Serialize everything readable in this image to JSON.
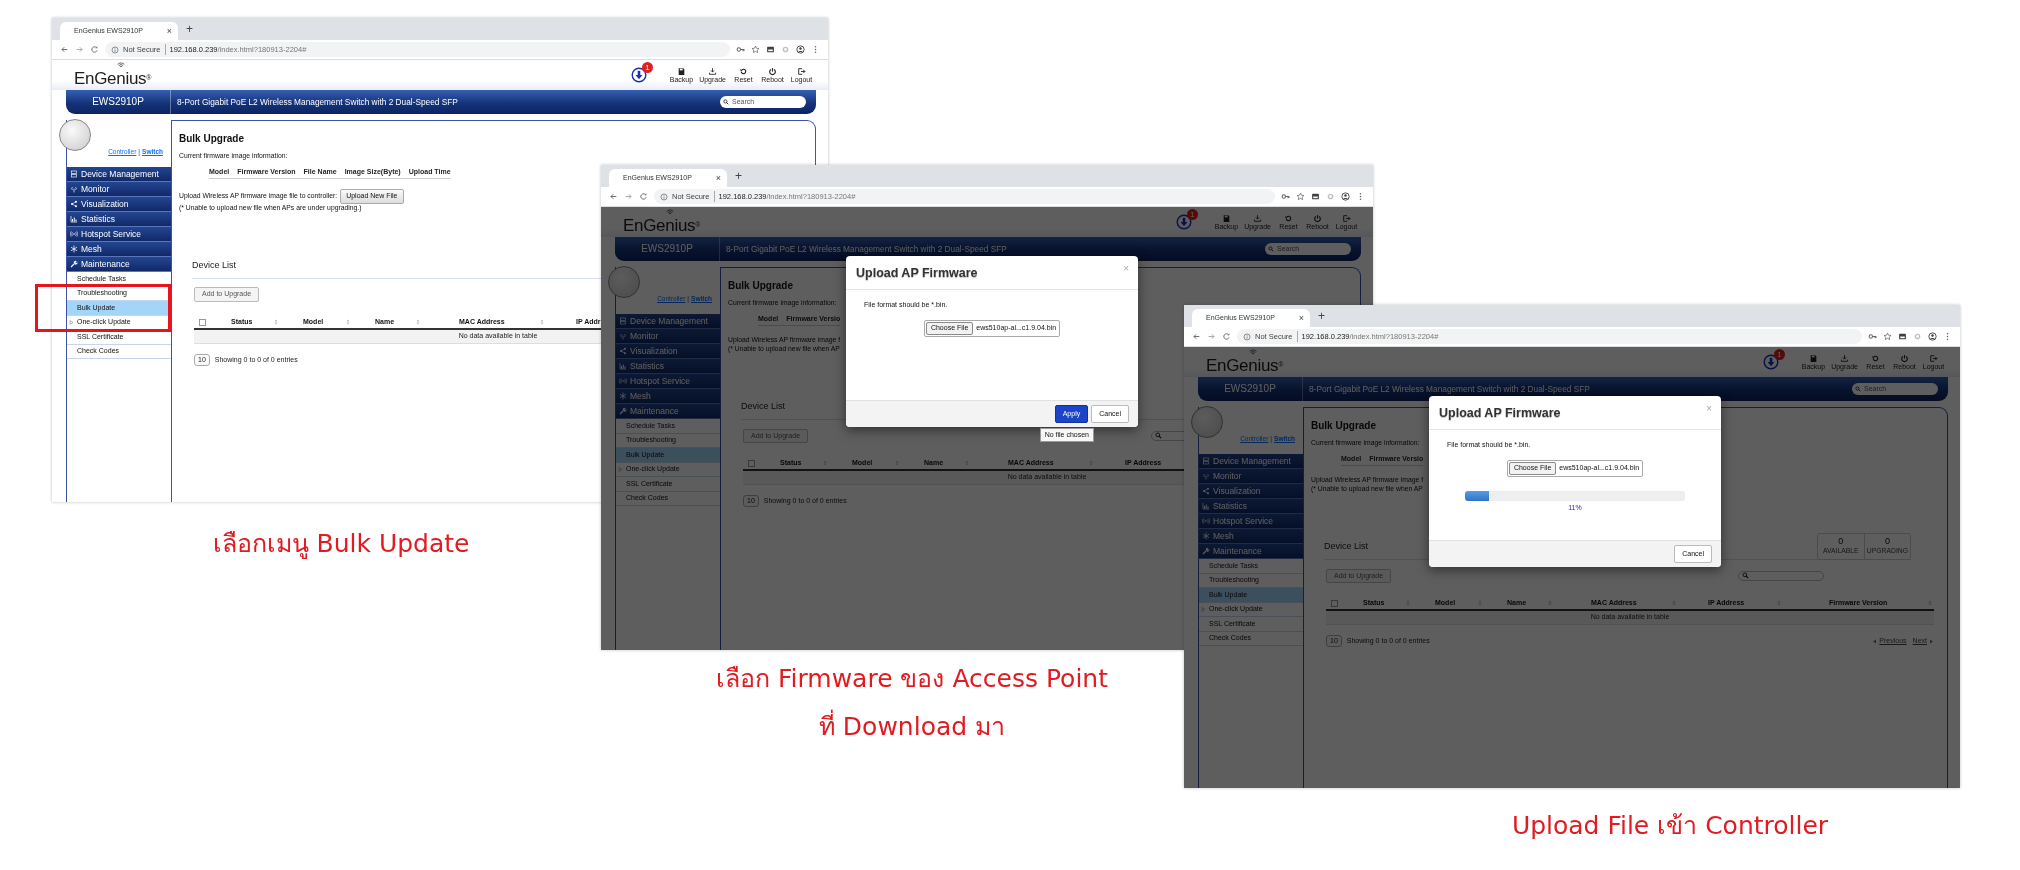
{
  "screenshots": [
    {
      "browser": {
        "tab_title": "EnGenius EWS2910P",
        "tab_close": "×",
        "new_tab": "+",
        "security": "Not Secure",
        "url": "**192.168.0.239**/index.html?180913-2204#"
      },
      "header": {
        "logo": "EnGenius$^{®}$",
        "notifications": "1",
        "toolbar": [
          "Backup",
          "Upgrade",
          "Reset",
          "Reboot",
          "Logout"
        ],
        "model": "EWS2910P",
        "description": "8-Port Gigabit PoE L2 Wireless Management Switch with 2 Dual-Speed SFP",
        "search_placeholder": "Search"
      },
      "sidebar": {
        "links": [
          "Controller",
          "Switch"
        ],
        "separator": "|",
        "menu": [
          "Device Management",
          "Monitor",
          "Visualization",
          "Statistics",
          "Hotspot Service",
          "Mesh",
          "Maintenance"
        ],
        "submenu": [
          {
            "label": "Schedule Tasks",
            "selected": false,
            "expandable": false,
            "highlighted": false
          },
          {
            "label": "Troubleshooting",
            "selected": false,
            "expandable": false,
            "highlighted": true
          },
          {
            "label": "Bulk Update",
            "selected": true,
            "expandable": false,
            "highlighted": true
          },
          {
            "label": "One-click Update",
            "selected": false,
            "expandable": true,
            "highlighted": true
          },
          {
            "label": "SSL Certificate",
            "selected": false,
            "expandable": false,
            "highlighted": false
          },
          {
            "label": "Check Codes",
            "selected": false,
            "expandable": false,
            "highlighted": false
          }
        ]
      },
      "main": {
        "title": "Bulk Upgrade",
        "info_label": "Current firmware image information:",
        "firmware_columns": [
          "Model",
          "Firmware Version",
          "File Name",
          "Image Size(Byte)",
          "Upload Time"
        ],
        "upload_label": "Upload Wireless AP firmware image file to controller:",
        "upload_button": "Upload New File",
        "note": "(* Unable to upload new file when APs are under upgrading.)",
        "device_list_title": "Device List",
        "add_button": {
          "label": "Add to Upgrade",
          "disabled": true
        },
        "select_all_checked": false,
        "columns": [
          "Status",
          "Model",
          "Name",
          "MAC Address",
          "IP Addr"
        ],
        "empty_text": "No data available in table",
        "page_size": "10",
        "entries": "Showing 0 to 0 of 0 entries"
      }
    },
    {
      "browser": {
        "tab_title": "EnGenius EWS2910P",
        "tab_close": "×",
        "new_tab": "+",
        "security": "Not Secure",
        "url": "**192.168.0.239**/index.html?180913-2204#"
      },
      "header": {
        "logo": "EnGenius$^{®}$",
        "notifications": "1",
        "toolbar": [
          "Backup",
          "Upgrade",
          "Reset",
          "Reboot",
          "Logout"
        ],
        "model": "EWS2910P",
        "description": "8-Port Gigabit PoE L2 Wireless Management Switch with 2 Dual-Speed SFP",
        "search_placeholder": "Search"
      },
      "sidebar": {
        "links": [
          "Controller",
          "Switch"
        ],
        "separator": "|",
        "menu": [
          "Device Management",
          "Monitor",
          "Visualization",
          "Statistics",
          "Hotspot Service",
          "Mesh",
          "Maintenance"
        ],
        "submenu": [
          {
            "label": "Schedule Tasks",
            "selected": false,
            "expandable": false
          },
          {
            "label": "Troubleshooting",
            "selected": false,
            "expandable": false
          },
          {
            "label": "Bulk Update",
            "selected": true,
            "expandable": false
          },
          {
            "label": "One-click Update",
            "selected": false,
            "expandable": true
          },
          {
            "label": "SSL Certificate",
            "selected": false,
            "expandable": false
          },
          {
            "label": "Check Codes",
            "selected": false,
            "expandable": false
          }
        ]
      },
      "main": {
        "title": "Bulk Upgrade",
        "info_label": "Current firmware image information:",
        "firmware_columns": [
          "Model",
          "Firmware Versio"
        ],
        "upload_label": "Upload Wireless AP firmware image f",
        "note": "(* Unable to upload new file when AP",
        "device_list_title": "Device List",
        "add_button": {
          "label": "Add to Upgrade",
          "disabled": true
        },
        "show_search": true,
        "select_all_checked": false,
        "columns": [
          "Status",
          "Model",
          "Name",
          "MAC Address",
          "IP Address"
        ],
        "empty_text": "No data available in table",
        "page_size": "10",
        "entries": "Showing 0 to 0 of 0 entries"
      },
      "modal": {
        "title": "Upload AP Firmware",
        "close": "×",
        "hint": "File format should be *.bin.",
        "choose_button": "Choose File",
        "file_name": "ews510ap-al...c1.9.04.bin",
        "buttons": [
          {
            "label": "Apply",
            "kind": "primary"
          },
          {
            "label": "Cancel",
            "kind": "default"
          }
        ],
        "tooltip": "No file chosen"
      }
    },
    {
      "browser": {
        "tab_title": "EnGenius EWS2910P",
        "tab_close": "×",
        "new_tab": "+",
        "security": "Not Secure",
        "url": "**192.168.0.239**/index.html?180913-2204#"
      },
      "header": {
        "logo": "EnGenius$^{®}$",
        "notifications": "1",
        "toolbar": [
          "Backup",
          "Upgrade",
          "Reset",
          "Reboot",
          "Logout"
        ],
        "model": "EWS2910P",
        "description": "8-Port Gigabit PoE L2 Wireless Management Switch with 2 Dual-Speed SFP",
        "search_placeholder": "Search"
      },
      "sidebar": {
        "links": [
          "Controller",
          "Switch"
        ],
        "separator": "|",
        "menu": [
          "Device Management",
          "Monitor",
          "Visualization",
          "Statistics",
          "Hotspot Service",
          "Mesh",
          "Maintenance"
        ],
        "submenu": [
          {
            "label": "Schedule Tasks",
            "selected": false,
            "expandable": false
          },
          {
            "label": "Troubleshooting",
            "selected": false,
            "expandable": false
          },
          {
            "label": "Bulk Update",
            "selected": true,
            "expandable": false
          },
          {
            "label": "One-click Update",
            "selected": false,
            "expandable": true
          },
          {
            "label": "SSL Certificate",
            "selected": false,
            "expandable": false
          },
          {
            "label": "Check Codes",
            "selected": false,
            "expandable": false
          }
        ]
      },
      "main": {
        "title": "Bulk Upgrade",
        "info_label": "Current firmware image information:",
        "firmware_columns": [
          "Model",
          "Firmware Versio"
        ],
        "upload_label": "Upload Wireless AP firmware image f",
        "note": "(* Unable to upload new file when AP",
        "counters": [
          {
            "value": "0",
            "label": "AVAILABLE"
          },
          {
            "value": "0",
            "label": "UPGRADING"
          }
        ],
        "device_list_title": "Device List",
        "add_button": {
          "label": "Add to Upgrade",
          "disabled": true
        },
        "show_search": true,
        "select_all_checked": false,
        "columns": [
          "Status",
          "Model",
          "Name",
          "MAC Address",
          "IP Address",
          "Firmware Version"
        ],
        "empty_text": "No data available in table",
        "page_size": "10",
        "entries": "Showing 0 to 0 of 0 entries",
        "pager": {
          "previous": "Previous",
          "next": "Next"
        }
      },
      "modal": {
        "title": "Upload AP Firmware",
        "close": "×",
        "hint": "File format should be *.bin.",
        "choose_button": "Choose File",
        "file_name": "ews510ap-al...c1.9.04.bin",
        "progress": {
          "level": 0.11,
          "label": "11%"
        },
        "buttons": [
          {
            "label": "Cancel",
            "kind": "default"
          }
        ]
      }
    }
  ],
  "captions": [
    {
      "lines": [
        "เลือกเมนู Bulk Update"
      ]
    },
    {
      "lines": [
        "เลือก Firmware ของ Access Point",
        "ที่ Download มา"
      ]
    },
    {
      "lines": [
        "Upload File เข้า Controller"
      ]
    }
  ]
}
